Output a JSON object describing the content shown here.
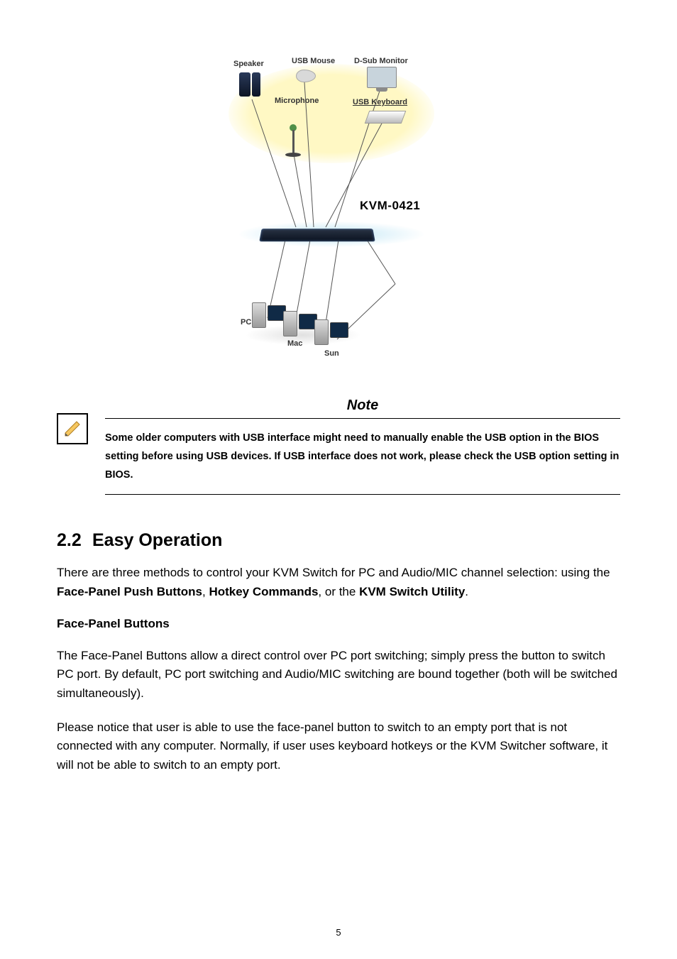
{
  "diagram": {
    "labels": {
      "speaker": "Speaker",
      "usb_mouse": "USB Mouse",
      "dsub_monitor": "D-Sub Monitor",
      "microphone": "Microphone",
      "usb_keyboard": "USB Keyboard",
      "pc": "PC",
      "mac": "Mac",
      "sun": "Sun"
    },
    "device_title": "KVM-0421"
  },
  "note": {
    "title": "Note",
    "text": "Some older computers with USB interface might need to manually enable the USB option in the BIOS setting before using USB devices. If USB interface does not work, please check the USB option setting in BIOS."
  },
  "section": {
    "number": "2.2",
    "title": "Easy Operation",
    "intro_pre": "There are three methods to control your KVM Switch for PC and Audio/MIC channel selection: using the ",
    "intro_b1": "Face-Panel Push Buttons",
    "intro_sep1": ", ",
    "intro_b2": "Hotkey Commands",
    "intro_sep2": ", or the ",
    "intro_b3": "KVM Switch Utility",
    "intro_post": ".",
    "subhead": "Face-Panel Buttons",
    "para2": "The Face-Panel Buttons allow a direct control over PC port switching; simply press the button to switch PC port. By default, PC port switching and Audio/MIC switching are bound together (both will be switched simultaneously).",
    "para3": "Please notice that user is able to use the face-panel button to switch to an empty port that is not connected with any computer. Normally, if user uses keyboard hotkeys or the KVM Switcher software, it will not be able to switch to an empty port."
  },
  "page_number": "5"
}
